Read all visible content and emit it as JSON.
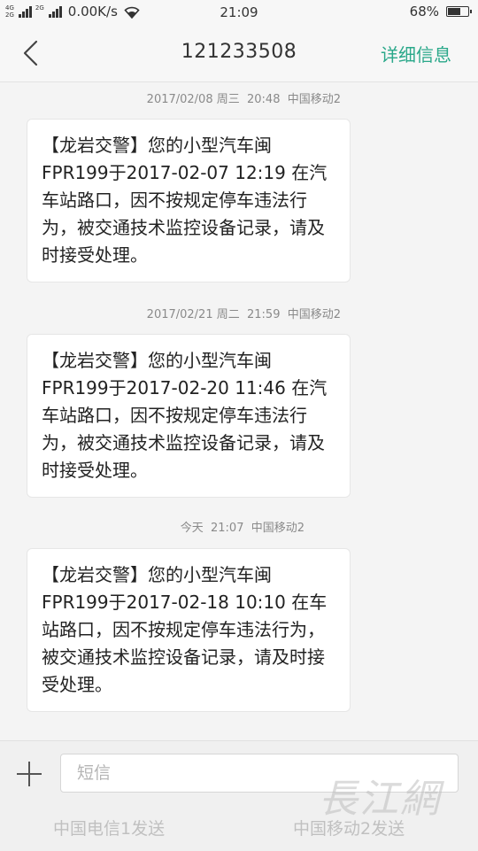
{
  "status_bar": {
    "net_tag_top": "4G",
    "net_tag_bottom": "2G",
    "net_tag_mid": "2G",
    "speed": "0.00K/s",
    "time": "21:09",
    "battery_percent": "68%",
    "battery_level": 0.68
  },
  "header": {
    "title": "121233508",
    "detail_label": "详细信息"
  },
  "messages": [
    {
      "meta": "2017/02/08 周三  20:48  中国移动2",
      "text": "【龙岩交警】您的小型汽车闽FPR199于2017-02-07 12:19 在汽车站路口，因不按规定停车违法行为，被交通技术监控设备记录，请及时接受处理。"
    },
    {
      "meta": "2017/02/21 周二  21:59  中国移动2",
      "text": "【龙岩交警】您的小型汽车闽FPR199于2017-02-20 11:46 在汽车站路口，因不按规定停车违法行为，被交通技术监控设备记录，请及时接受处理。"
    },
    {
      "meta": "今天  21:07  中国移动2",
      "text": "【龙岩交警】您的小型汽车闽FPR199于2017-02-18 10:10 在车站路口，因不按规定停车违法行为，被交通技术监控设备记录，请及时接受处理。"
    }
  ],
  "composer": {
    "placeholder": "短信",
    "send_sim1": "中国电信1发送",
    "send_sim2": "中国移动2发送"
  },
  "watermark": "長江網"
}
